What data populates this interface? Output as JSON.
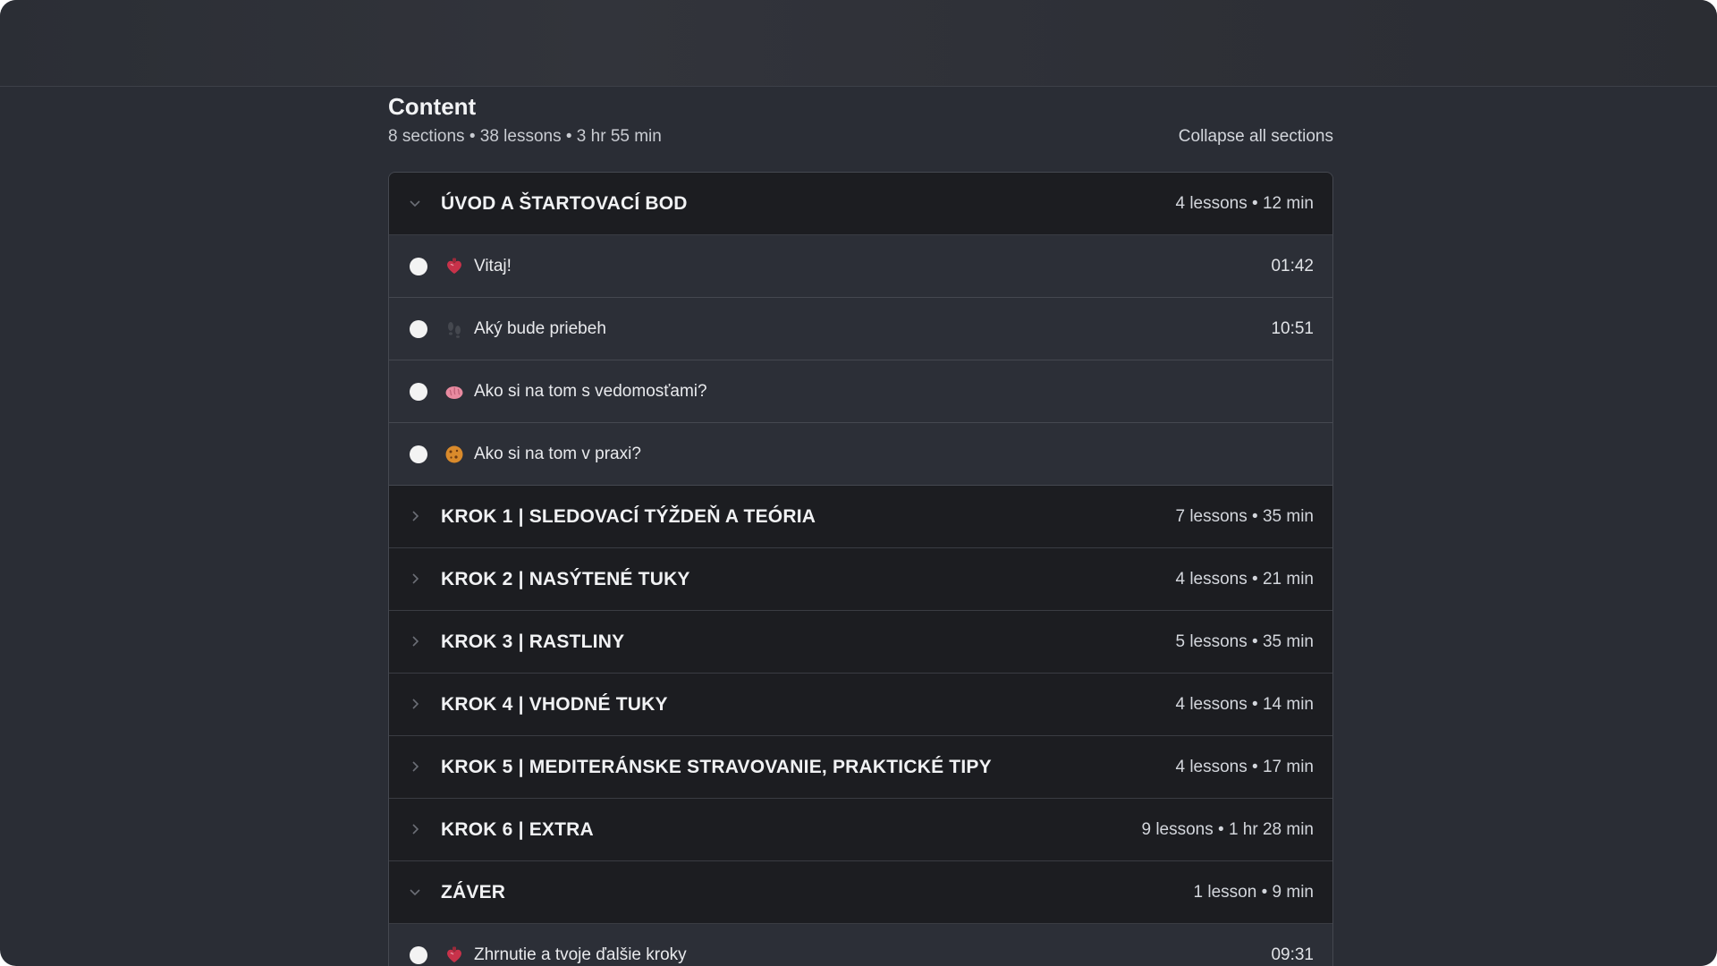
{
  "header": {
    "title": "Content",
    "summary": "8 sections • 38 lessons • 3 hr 55 min",
    "collapse_label": "Collapse all sections"
  },
  "sections": [
    {
      "title": "ÚVOD A ŠTARTOVACÍ BOD",
      "meta": "4 lessons • 12 min",
      "expanded": true,
      "lessons": [
        {
          "icon": "heart-icon",
          "title": "Vitaj!",
          "duration": "01:42"
        },
        {
          "icon": "footprints-icon",
          "title": "Aký bude priebeh",
          "duration": "10:51"
        },
        {
          "icon": "brain-icon",
          "title": "Ako si na tom s vedomosťami?",
          "duration": ""
        },
        {
          "icon": "cookie-icon",
          "title": "Ako si na tom v praxi?",
          "duration": ""
        }
      ]
    },
    {
      "title": "KROK 1 | SLEDOVACÍ TÝŽDEŇ A TEÓRIA",
      "meta": "7 lessons • 35 min",
      "expanded": false
    },
    {
      "title": "KROK 2 | NASÝTENÉ TUKY",
      "meta": "4 lessons • 21 min",
      "expanded": false
    },
    {
      "title": "KROK 3 | RASTLINY",
      "meta": "5 lessons • 35 min",
      "expanded": false
    },
    {
      "title": "KROK 4 | VHODNÉ TUKY",
      "meta": "4 lessons • 14 min",
      "expanded": false
    },
    {
      "title": "KROK 5 | MEDITERÁNSKE STRAVOVANIE, PRAKTICKÉ TIPY",
      "meta": "4 lessons • 17 min",
      "expanded": false
    },
    {
      "title": "KROK 6 | EXTRA",
      "meta": "9 lessons • 1 hr 28 min",
      "expanded": false
    },
    {
      "title": "ZÁVER",
      "meta": "1 lesson • 9 min",
      "expanded": true,
      "lessons": [
        {
          "icon": "heart-icon",
          "title": "Zhrnutie a tvoje ďalšie kroky",
          "duration": "09:31"
        }
      ]
    }
  ],
  "colors": {
    "background": "#2a2d35",
    "section_row": "#1c1d21",
    "lesson_row": "#2c2f37",
    "text": "#f1f2f4",
    "heart": "#c8324a",
    "brain": "#e88aa0",
    "cookie": "#d98a2b"
  }
}
